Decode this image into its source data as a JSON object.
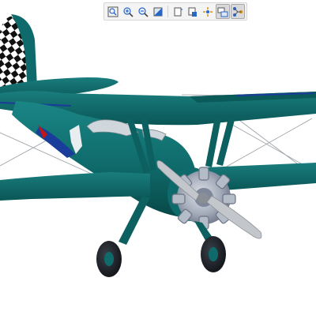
{
  "toolbar": {
    "buttons": [
      {
        "name": "zoom-fit-icon",
        "active": false
      },
      {
        "name": "zoom-in-icon",
        "active": false
      },
      {
        "name": "zoom-out-icon",
        "active": false
      },
      {
        "name": "shading-style-icon",
        "active": false
      },
      {
        "name": "view-orientation-icon",
        "active": false
      },
      {
        "name": "saved-views-icon",
        "active": false
      },
      {
        "name": "spin-center-icon",
        "active": false
      },
      {
        "name": "display-settings-icon",
        "active": true
      },
      {
        "name": "model-tree-icon",
        "active": true
      }
    ]
  },
  "model": {
    "body_color": "#0f6b6b",
    "body_dark_color": "#0a5050",
    "engine_color": "#9aa3b0",
    "propeller_color": "#b9bcc0",
    "tire_color": "#1a1d22",
    "stripe_color": "#1a3c9a",
    "accent_color": "#c01818",
    "background": "#ffffff"
  }
}
